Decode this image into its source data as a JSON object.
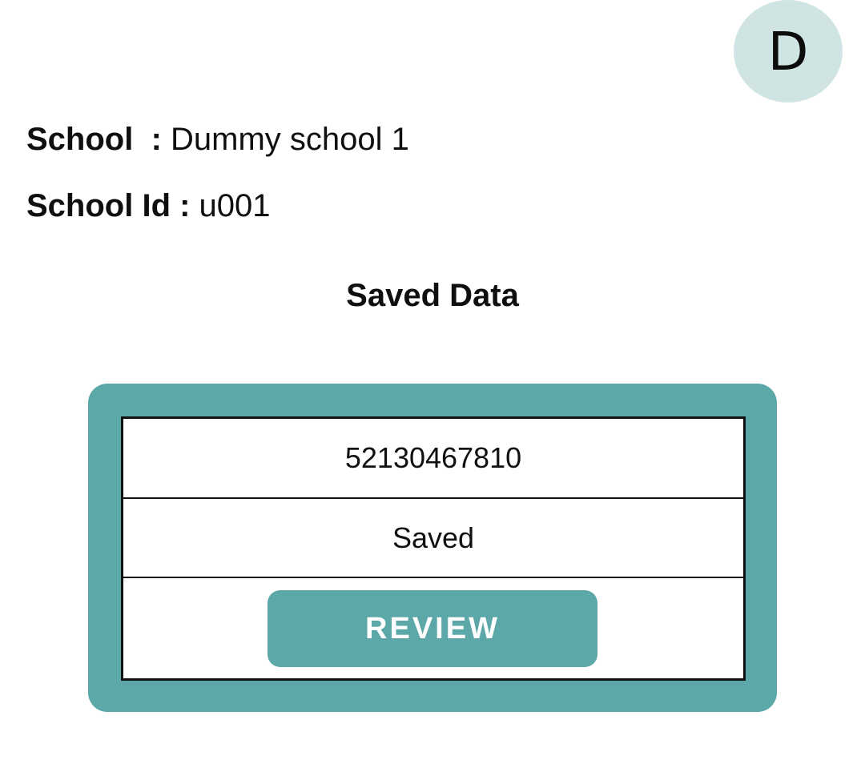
{
  "header": {
    "avatar_initial": "D"
  },
  "school_info": {
    "school_label": "School  :",
    "school_value": " Dummy school 1",
    "school_id_label": "School Id :",
    "school_id_value": " u001"
  },
  "section": {
    "title": "Saved Data"
  },
  "saved_record": {
    "id": "52130467810",
    "status": "Saved",
    "action_label": "REVIEW"
  },
  "colors": {
    "accent": "#5ca8a8",
    "avatar_bg": "#cfe4e3",
    "text": "#111111",
    "background": "#ffffff"
  }
}
